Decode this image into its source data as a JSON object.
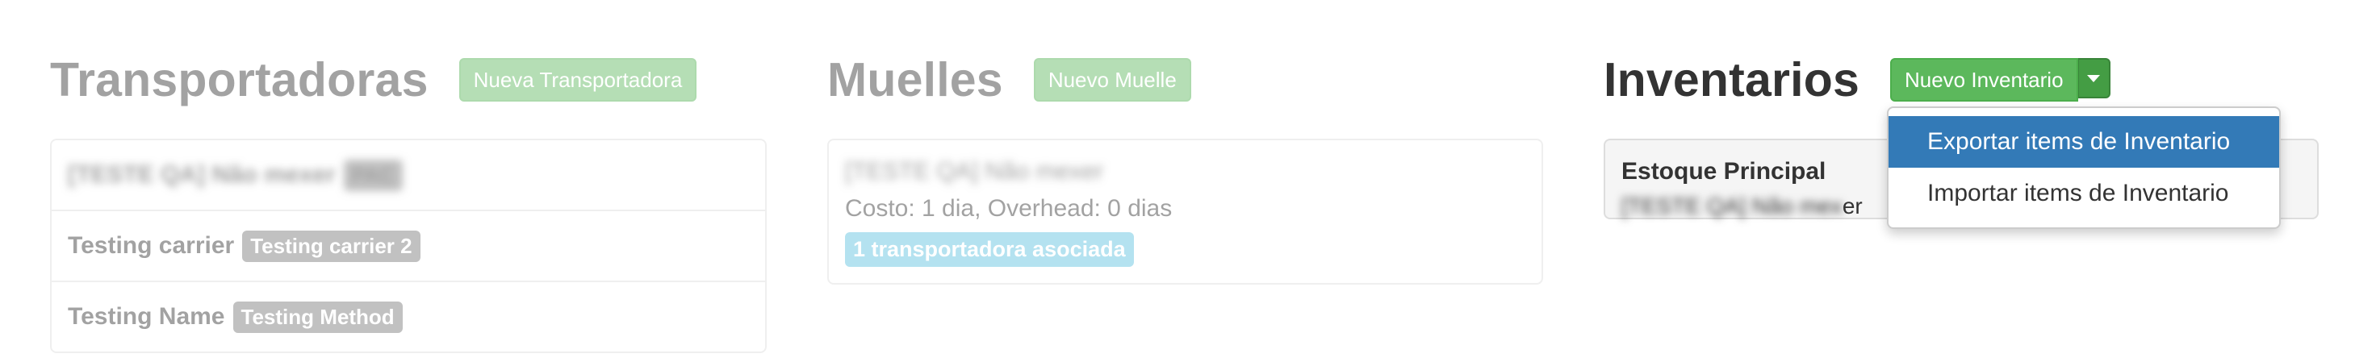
{
  "transportadoras": {
    "title": "Transportadoras",
    "new_button": "Nueva Transportadora",
    "items": [
      {
        "name": "[TESTE QA] Não mexer",
        "badge": "PAC"
      },
      {
        "name": "Testing carrier",
        "badge": "Testing carrier 2"
      },
      {
        "name": "Testing Name",
        "badge": "Testing Method"
      }
    ]
  },
  "muelles": {
    "title": "Muelles",
    "new_button": "Nuevo Muelle",
    "item": {
      "name": "[TESTE QA] Não mexer",
      "cost_text": "Costo: 1 dia, Overhead: 0 dias",
      "badge": "1 transportadora asociada"
    }
  },
  "inventarios": {
    "title": "Inventarios",
    "new_button": "Nuevo Inventario",
    "item": {
      "title": "Estoque Principal",
      "subtitle_blurred": "[TESTE QA] Não mex",
      "subtitle_visible": "er"
    },
    "dropdown": [
      {
        "label": "Exportar items de Inventario",
        "active": true
      },
      {
        "label": "Importar items de Inventario",
        "active": false
      }
    ]
  },
  "colors": {
    "success": "#5cb85c",
    "info": "#5bc0de",
    "primary_active": "#337ab7",
    "label_gray": "#777777"
  }
}
